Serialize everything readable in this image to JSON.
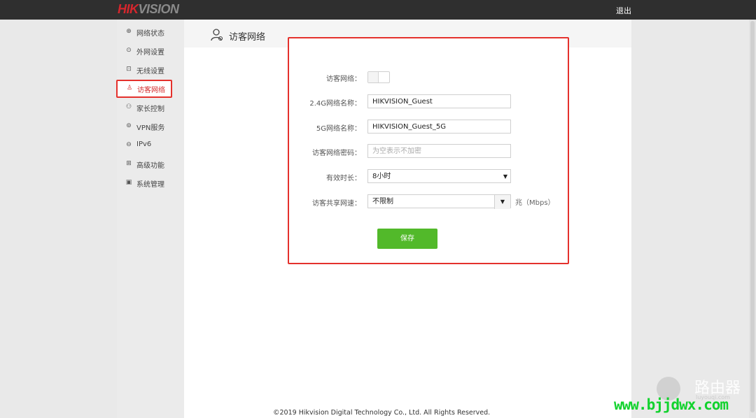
{
  "brand": {
    "hik": "HIK",
    "vision": "VISION"
  },
  "header": {
    "logout": "退出"
  },
  "sidebar": {
    "items": [
      {
        "label": "网络状态",
        "icon": "globe-icon",
        "glyph": "⊕"
      },
      {
        "label": "外网设置",
        "icon": "wan-icon",
        "glyph": "⊙"
      },
      {
        "label": "无线设置",
        "icon": "wifi-icon",
        "glyph": "⊡"
      },
      {
        "label": "访客网络",
        "icon": "guest-icon",
        "glyph": "♙"
      },
      {
        "label": "家长控制",
        "icon": "parental-icon",
        "glyph": "⚇"
      },
      {
        "label": "VPN服务",
        "icon": "vpn-icon",
        "glyph": "⊚"
      },
      {
        "label": "IPv6",
        "icon": "ipv6-icon",
        "glyph": "⊖"
      },
      {
        "label": "高级功能",
        "icon": "advanced-icon",
        "glyph": "⊞"
      },
      {
        "label": "系统管理",
        "icon": "system-icon",
        "glyph": "▣"
      }
    ],
    "active_index": 3
  },
  "page": {
    "title": "访客网络"
  },
  "form": {
    "guest_network_label": "访客网络：",
    "guest_network_enabled": false,
    "ssid24_label": "2.4G网络名称：",
    "ssid24_value": "HIKVISION_Guest",
    "ssid5_label": "5G网络名称：",
    "ssid5_value": "HIKVISION_Guest_5G",
    "password_label": "访客网络密码：",
    "password_placeholder": "为空表示不加密",
    "duration_label": "有效时长：",
    "duration_value": "8小时",
    "speed_label": "访客共享网速：",
    "speed_value": "不限制",
    "speed_unit": "兆（Mbps）",
    "save": "保存"
  },
  "footer": {
    "copyright": "©2019 Hikvision Digital Technology Co., Ltd. All Rights Reserved."
  },
  "watermark": {
    "brand": "路由器",
    "sub": "luyouqi.com",
    "url": "www.bjjdwx.com"
  },
  "colors": {
    "accent_red": "#e4312c",
    "save_green": "#52b92a",
    "topbar": "#2f2f2f"
  }
}
